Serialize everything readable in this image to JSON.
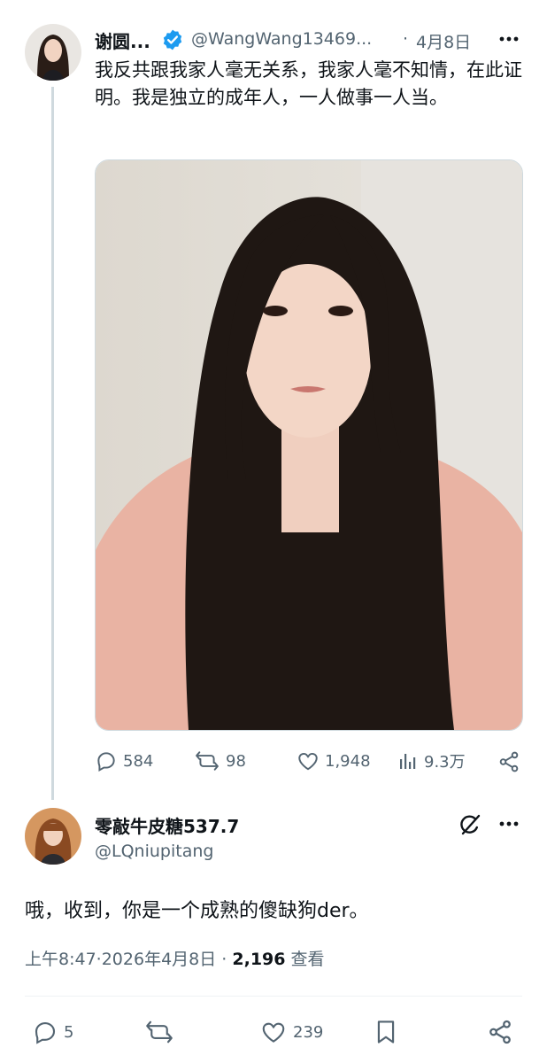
{
  "parent_tweet": {
    "display_name": "谢圆...",
    "handle": "@WangWang13469...",
    "separator": "·",
    "date": "4月8日",
    "more_icon": "more-horizontal-icon",
    "verified_icon": "verified-badge-icon",
    "text": "我反共跟我家人毫无关系，我家人毫不知情，在此证明。我是独立的成年人，一人做事一人当。",
    "actions": {
      "replies": "584",
      "retweets": "98",
      "likes": "1,948",
      "views": "9.3万"
    }
  },
  "reply_tweet": {
    "display_name": "零敲牛皮糖537.7",
    "handle": "@LQniupitang",
    "grok_icon": "grok-icon",
    "more_icon": "more-horizontal-icon",
    "text": "哦，收到，你是一个成熟的傻缺狗der。",
    "time": "上午8:47",
    "date": "2026年4月8日",
    "separator": "·",
    "views_count": "2,196",
    "views_label": "查看",
    "actions": {
      "replies": "5",
      "likes": "239"
    }
  },
  "colors": {
    "text": "#0f1419",
    "muted": "#536471",
    "verified": "#1d9bf0",
    "border": "#cfd9de"
  }
}
